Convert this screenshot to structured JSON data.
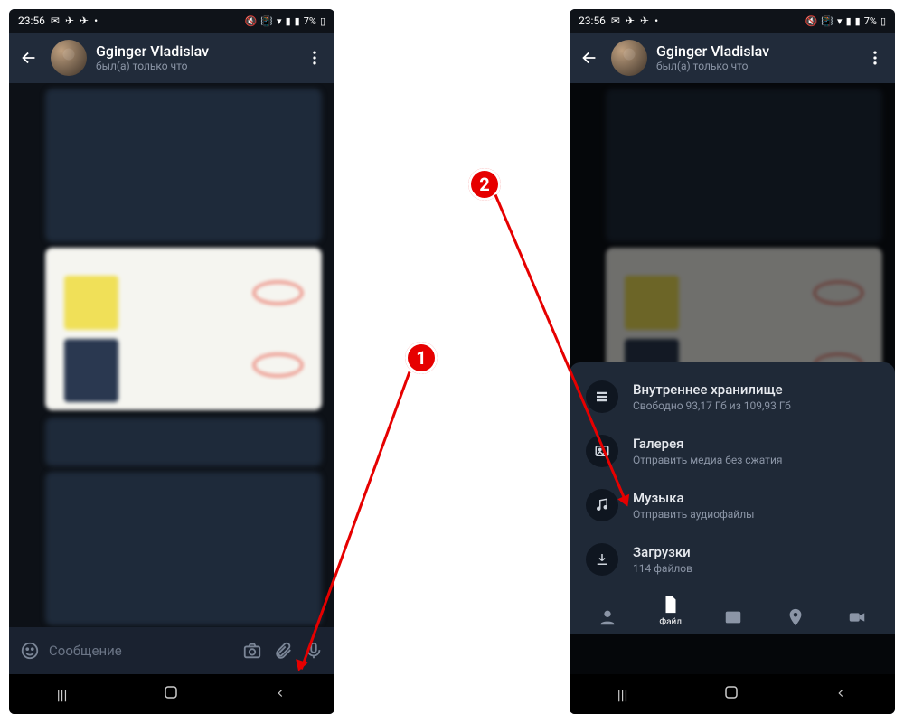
{
  "statusbar": {
    "time": "23:56",
    "battery": "7%",
    "icons": [
      "mail-icon",
      "send-icon",
      "send-icon",
      "more-icon",
      "mute-icon",
      "vibrate-icon",
      "wifi-icon",
      "signal-icon",
      "signal-icon"
    ]
  },
  "header": {
    "name": "Gginger Vladislav",
    "status": "был(а) только что"
  },
  "input": {
    "placeholder": "Сообщение"
  },
  "sheet": {
    "items": [
      {
        "icon": "storage-icon",
        "title": "Внутреннее хранилище",
        "subtitle": "Свободно 93,17 Гб из 109,93 Гб"
      },
      {
        "icon": "image-icon",
        "title": "Галерея",
        "subtitle": "Отправить медиа без сжатия"
      },
      {
        "icon": "music-icon",
        "title": "Музыка",
        "subtitle": "Отправить аудиофайлы"
      },
      {
        "icon": "download-icon",
        "title": "Загрузки",
        "subtitle": "114 файлов"
      }
    ],
    "tabs": [
      {
        "icon": "person-icon",
        "label": ""
      },
      {
        "icon": "file-icon",
        "label": "Файл",
        "active": true
      },
      {
        "icon": "gallery-icon",
        "label": ""
      },
      {
        "icon": "location-icon",
        "label": ""
      },
      {
        "icon": "video-icon",
        "label": ""
      }
    ]
  },
  "callouts": {
    "step1": "1",
    "step2": "2"
  }
}
